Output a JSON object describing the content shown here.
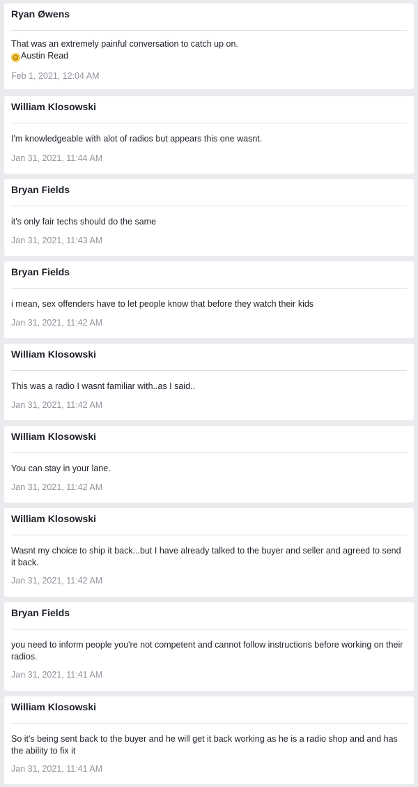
{
  "messages": [
    {
      "author": "Ryan Øwens",
      "text": "That was an extremely painful conversation to catch up on.",
      "mention": {
        "icon": "grinning-face-emoji",
        "glyph": "☺",
        "name": "Austin Read"
      },
      "time": "Feb 1, 2021, 12:04 AM"
    },
    {
      "author": "William Klosowski",
      "text": "I'm knowledgeable with alot of radios but appears this one wasnt.",
      "time": "Jan 31, 2021, 11:44 AM"
    },
    {
      "author": "Bryan Fields",
      "text": "it's only fair techs should do the same",
      "time": "Jan 31, 2021, 11:43 AM"
    },
    {
      "author": "Bryan Fields",
      "text": "i mean, sex offenders have to let people know that before they watch their kids",
      "time": "Jan 31, 2021, 11:42 AM"
    },
    {
      "author": "William Klosowski",
      "text": "This was a radio I wasnt familiar with..as I said..",
      "time": "Jan 31, 2021, 11:42 AM"
    },
    {
      "author": "William Klosowski",
      "text": "You can stay in your lane.",
      "time": "Jan 31, 2021, 11:42 AM"
    },
    {
      "author": "William Klosowski",
      "text": "Wasnt my choice to ship it back...but I have already talked to the buyer and seller and agreed to send it back.",
      "time": "Jan 31, 2021, 11:42 AM"
    },
    {
      "author": "Bryan Fields",
      "text": "you need to inform people you're not competent and cannot follow instructions before working on their radios.",
      "time": "Jan 31, 2021, 11:41 AM"
    },
    {
      "author": "William Klosowski",
      "text": "So it's being sent back to the buyer and he will get it back working as he is a radio shop and and has the ability to fix it",
      "time": "Jan 31, 2021, 11:41 AM"
    }
  ]
}
